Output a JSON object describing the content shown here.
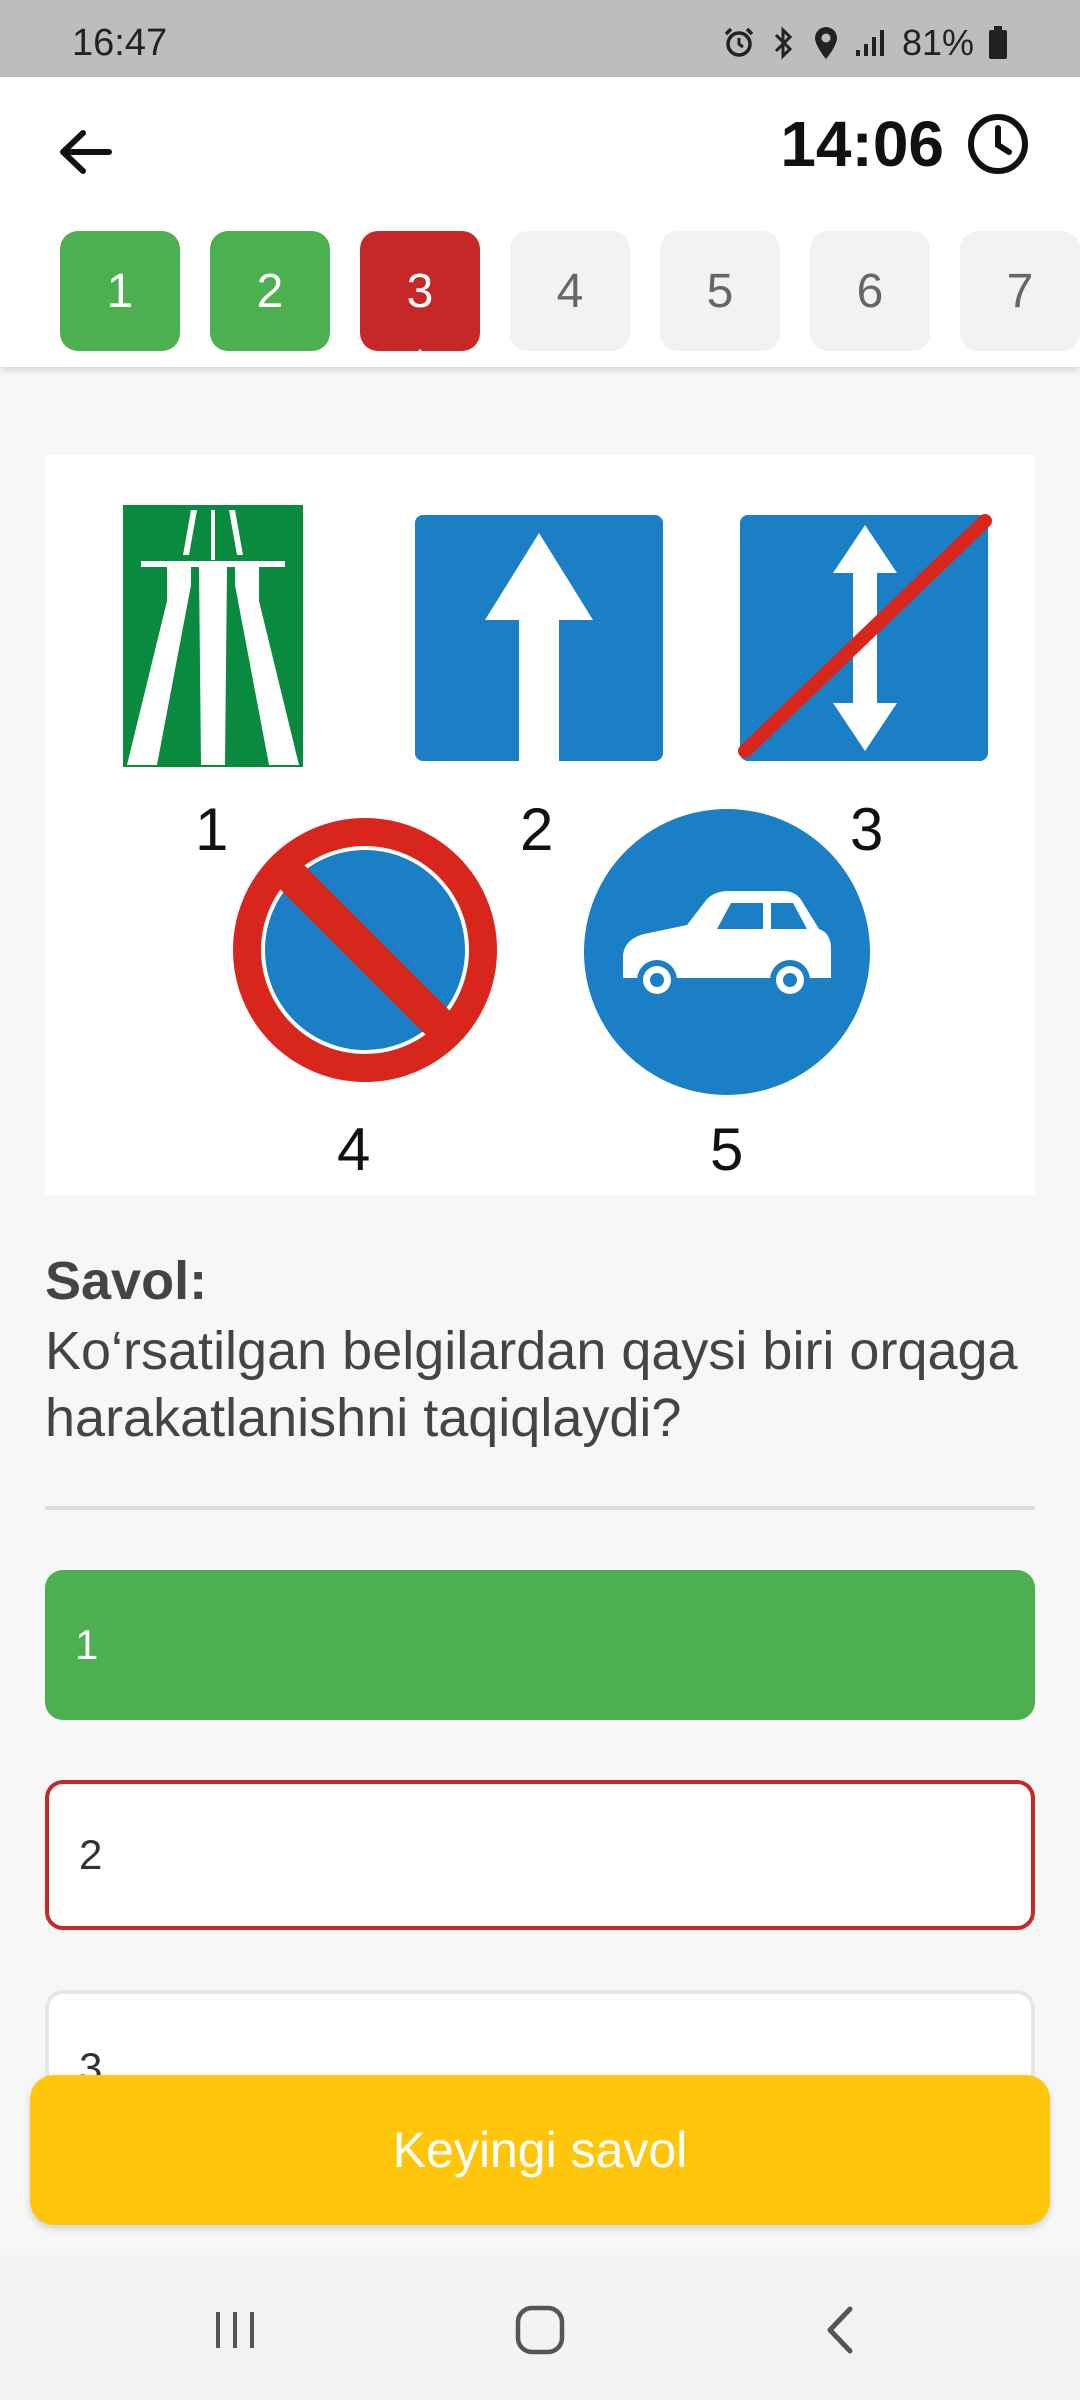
{
  "status_bar": {
    "time": "16:47",
    "battery": "81%",
    "icons": [
      "alarm-icon",
      "bluetooth-icon",
      "location-icon",
      "signal-icon",
      "battery-icon"
    ]
  },
  "header": {
    "back_icon": "arrow-left-icon",
    "timer": "14:06",
    "timer_icon": "clock-icon"
  },
  "question_nav": [
    {
      "label": "1",
      "state": "correct"
    },
    {
      "label": "2",
      "state": "correct"
    },
    {
      "label": "3",
      "state": "wrong"
    },
    {
      "label": "4",
      "state": "pending"
    },
    {
      "label": "5",
      "state": "pending"
    },
    {
      "label": "6",
      "state": "pending"
    },
    {
      "label": "7",
      "state": "pending"
    }
  ],
  "image": {
    "labels": [
      "1",
      "2",
      "3",
      "4",
      "5"
    ]
  },
  "question": {
    "heading": "Savol:",
    "text": "Ko‘rsatilgan belgilardan qaysi biri orqaga harakatlanishni taqiqlaydi?"
  },
  "answers": [
    {
      "label": "1",
      "state": "correct"
    },
    {
      "label": "2",
      "state": "wrong"
    },
    {
      "label": "3",
      "state": "normal"
    }
  ],
  "next_button": "Keyingi savol",
  "colors": {
    "correct": "#4caf50",
    "wrong": "#c62828",
    "accent": "#ffc60b",
    "sign_green": "#0a8a3e",
    "sign_blue": "#1a7fc5",
    "sign_red": "#d8261c"
  }
}
